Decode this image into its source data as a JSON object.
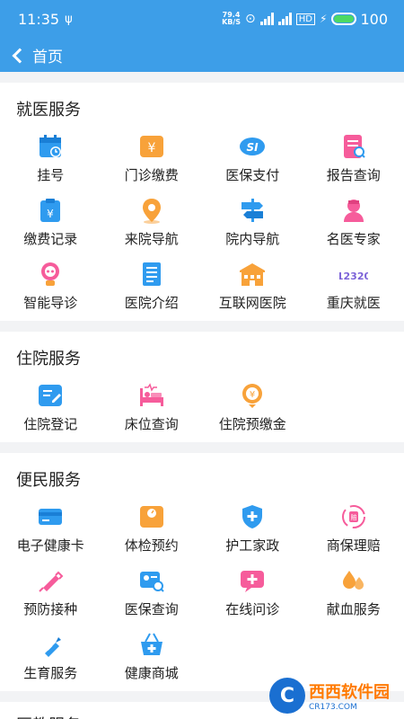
{
  "status": {
    "time": "11:35",
    "net_speed_value": "79.4",
    "net_speed_unit": "KB/S",
    "battery": "100"
  },
  "title_bar": {
    "back_label": "首页"
  },
  "sections": [
    {
      "title": "就医服务",
      "items": [
        {
          "label": "挂号",
          "icon": "calendar-icon"
        },
        {
          "label": "门诊缴费",
          "icon": "yuan-icon"
        },
        {
          "label": "医保支付",
          "icon": "si-icon"
        },
        {
          "label": "报告查询",
          "icon": "report-icon"
        },
        {
          "label": "缴费记录",
          "icon": "clipboard-yuan-icon"
        },
        {
          "label": "来院导航",
          "icon": "map-pin-icon"
        },
        {
          "label": "院内导航",
          "icon": "signpost-icon"
        },
        {
          "label": "名医专家",
          "icon": "doctor-icon"
        },
        {
          "label": "智能导诊",
          "icon": "robot-icon"
        },
        {
          "label": "医院介绍",
          "icon": "document-icon"
        },
        {
          "label": "互联网医院",
          "icon": "hospital-icon"
        },
        {
          "label": "重庆就医",
          "icon": "12320-icon"
        }
      ]
    },
    {
      "title": "住院服务",
      "items": [
        {
          "label": "住院登记",
          "icon": "register-icon"
        },
        {
          "label": "床位查询",
          "icon": "bed-icon"
        },
        {
          "label": "住院预缴金",
          "icon": "coin-icon"
        }
      ]
    },
    {
      "title": "便民服务",
      "items": [
        {
          "label": "电子健康卡",
          "icon": "card-icon"
        },
        {
          "label": "体检预约",
          "icon": "scale-icon"
        },
        {
          "label": "护工家政",
          "icon": "shield-plus-icon"
        },
        {
          "label": "商保理赔",
          "icon": "claim-icon"
        },
        {
          "label": "预防接种",
          "icon": "syringe-icon"
        },
        {
          "label": "医保查询",
          "icon": "id-search-icon"
        },
        {
          "label": "在线问诊",
          "icon": "chat-plus-icon"
        },
        {
          "label": "献血服务",
          "icon": "blood-drop-icon"
        },
        {
          "label": "生育服务",
          "icon": "bottle-icon"
        },
        {
          "label": "健康商城",
          "icon": "basket-icon"
        }
      ]
    }
  ],
  "next_section_title": "医教服务",
  "watermark": {
    "logo": "C",
    "main": "西西软件园",
    "sub": "CR173.COM"
  },
  "colors": {
    "primary": "#3d9ee8",
    "orange": "#f8a23a",
    "pink": "#f65c9b",
    "blue": "#2f9bef"
  }
}
